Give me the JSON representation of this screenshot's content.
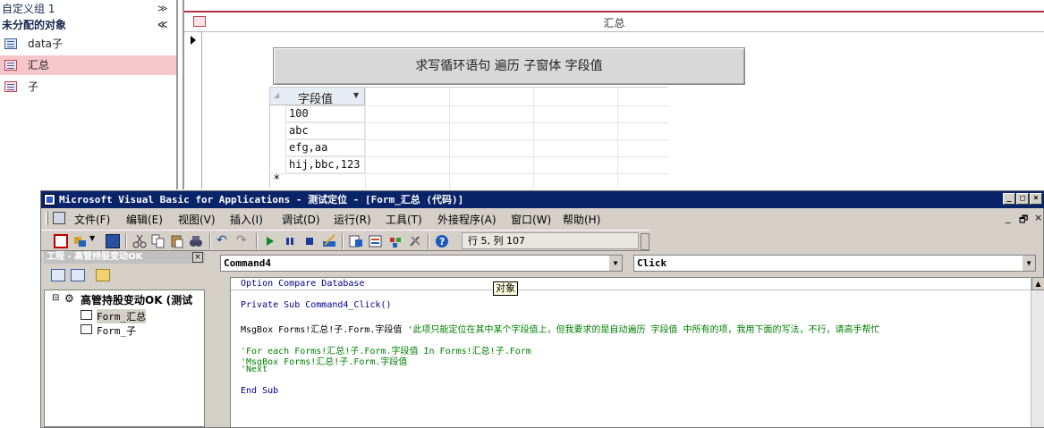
{
  "nav": {
    "groups": [
      {
        "label": "自定义组 1",
        "chevron": "≫"
      },
      {
        "label": "未分配的对象",
        "chevron": "≪"
      }
    ],
    "items": [
      {
        "label": "data子",
        "icon": "table-icon"
      },
      {
        "label": "汇总",
        "icon": "form-icon"
      },
      {
        "label": "子",
        "icon": "form-icon"
      }
    ]
  },
  "form": {
    "title": "汇总",
    "button_label": "求写循环语句   遍历 子窗体 字段值",
    "subform": {
      "column_header": "字段值",
      "rows": [
        "100",
        "abc",
        "efg,aa",
        "hij,bbc,123"
      ],
      "new_row_marker": "*"
    }
  },
  "vba": {
    "title": "Microsoft Visual Basic for Applications - 测试定位 - [Form_汇总 (代码)]",
    "window_buttons": [
      "_",
      "□",
      "×"
    ],
    "menus": [
      "文件(F)",
      "编辑(E)",
      "视图(V)",
      "插入(I)",
      "调试(D)",
      "运行(R)",
      "工具(T)",
      "外接程序(A)",
      "窗口(W)",
      "帮助(H)"
    ],
    "mdi_controls": [
      "_",
      "🗗",
      "×"
    ],
    "position_status": "行 5, 列 107",
    "project": {
      "title": "工程 - 高管持股变动OK",
      "root": "高管持股变动OK (测试",
      "children": [
        "Form_汇总",
        "Form_子"
      ]
    },
    "object_combo": "Command4",
    "procedure_combo": "Click",
    "tooltip": "对象",
    "code_lines": [
      "Option Compare Database",
      "Private Sub Command4_Click()",
      "MsgBox Forms!汇总!子.Form.字段值",
      "'此项只能定位在其中某个字段值上，但我要求的是自动遍历 字段值  中所有的项，我用下面的写法，不行，请高手帮忙",
      "'For each Forms!汇总!子.Form.字段值 In Forms!汇总!子.Form",
      "'MsgBox Forms!汇总!子.Form.字段值",
      "'Next",
      "End Sub"
    ]
  }
}
